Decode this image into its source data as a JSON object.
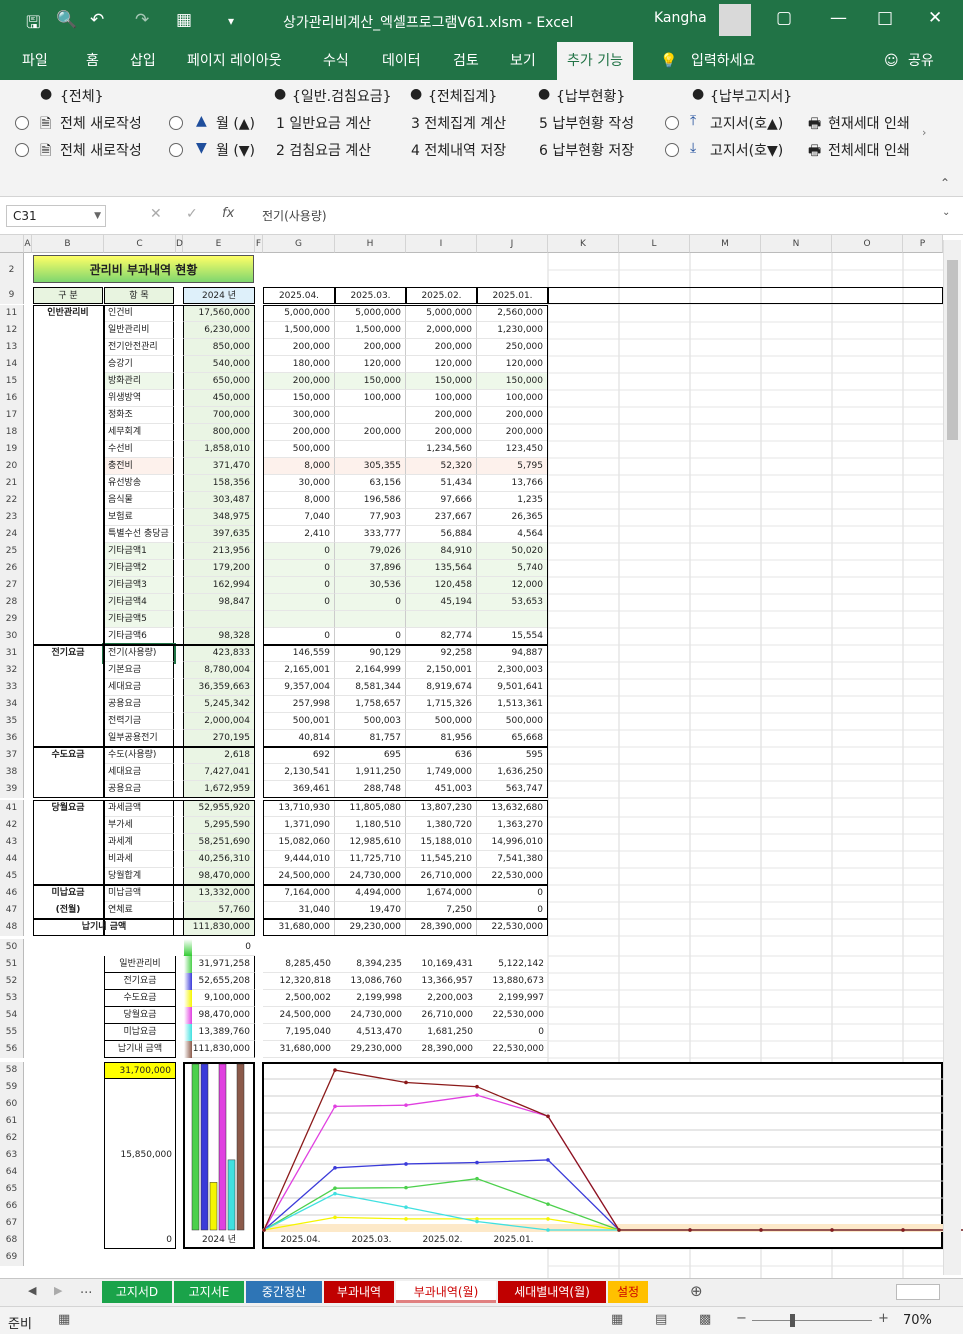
{
  "titlebar": {
    "title": "상가관리비계산_엑셀프로그램V61.xlsm  -  Excel",
    "user": "Kangha"
  },
  "menu": {
    "tabs": [
      "파일",
      "홈",
      "삽입",
      "페이지 레이아웃",
      "수식",
      "데이터",
      "검토",
      "보기",
      "추가 기능"
    ],
    "tellme": "입력하세요",
    "share": "공유"
  },
  "ribbon": {
    "groups": [
      "{전체}",
      "{일반.검침요금}",
      "{전체집계}",
      "{납부현황}",
      "{납부고지서}"
    ],
    "row1": [
      "전체 새로작성",
      "월 (▲)",
      "1  일반요금 계산",
      "3  전체집계 계산",
      "5  납부현황 작성",
      "고지서(호▲)",
      "현재세대 인쇄"
    ],
    "row2": [
      "전체 새로작성",
      "월 (▼)",
      "2  검침요금 계산",
      "4  전체내역 저장",
      "6  납부현황 저장",
      "고지서(호▼)",
      "전체세대 인쇄"
    ]
  },
  "formula": {
    "namebox": "C31",
    "value": "전기(사용량)"
  },
  "columns": [
    "A",
    "B",
    "C",
    "D",
    "E",
    "F",
    "G",
    "H",
    "I",
    "J",
    "K",
    "L",
    "M",
    "N",
    "O",
    "P"
  ],
  "sheet": {
    "title": "관리비 부과내역 현황",
    "header": {
      "gubun": "구  분",
      "hangmok": "항  목",
      "year": "2024 년",
      "months": [
        "2025.04.",
        "2025.03.",
        "2025.02.",
        "2025.01."
      ]
    },
    "sections": [
      {
        "name": "인반관리비",
        "row": 11
      },
      {
        "name": "전기요금",
        "row": 31
      },
      {
        "name": "수도요금",
        "row": 37
      },
      {
        "name": "당월요금",
        "row": 41
      },
      {
        "name": "미납요금",
        "row": 46
      },
      {
        "name": "(전월)",
        "row": 47
      },
      {
        "name": "납기내 금액",
        "row": 48
      }
    ],
    "rows": [
      {
        "r": "11",
        "item": "인건비",
        "year": "17,560,000",
        "m": [
          "5,000,000",
          "5,000,000",
          "5,000,000",
          "2,560,000"
        ]
      },
      {
        "r": "12",
        "item": "일반관리비",
        "year": "6,230,000",
        "m": [
          "1,500,000",
          "1,500,000",
          "2,000,000",
          "1,230,000"
        ]
      },
      {
        "r": "13",
        "item": "전기안전관리",
        "year": "850,000",
        "m": [
          "200,000",
          "200,000",
          "200,000",
          "250,000"
        ]
      },
      {
        "r": "14",
        "item": "승강기",
        "year": "540,000",
        "m": [
          "180,000",
          "120,000",
          "120,000",
          "120,000"
        ]
      },
      {
        "r": "15",
        "item": "방화관리",
        "year": "650,000",
        "m": [
          "200,000",
          "150,000",
          "150,000",
          "150,000"
        ]
      },
      {
        "r": "16",
        "item": "위생방역",
        "year": "450,000",
        "m": [
          "150,000",
          "100,000",
          "100,000",
          "100,000"
        ]
      },
      {
        "r": "17",
        "item": "정화조",
        "year": "700,000",
        "m": [
          "300,000",
          "",
          "200,000",
          "200,000"
        ]
      },
      {
        "r": "18",
        "item": "세무회계",
        "year": "800,000",
        "m": [
          "200,000",
          "200,000",
          "200,000",
          "200,000"
        ]
      },
      {
        "r": "19",
        "item": "수선비",
        "year": "1,858,010",
        "m": [
          "500,000",
          "",
          "1,234,560",
          "123,450"
        ]
      },
      {
        "r": "20",
        "item": "충전비",
        "year": "371,470",
        "m": [
          "8,000",
          "305,355",
          "52,320",
          "5,795"
        ]
      },
      {
        "r": "21",
        "item": "유선방송",
        "year": "158,356",
        "m": [
          "30,000",
          "63,156",
          "51,434",
          "13,766"
        ]
      },
      {
        "r": "22",
        "item": "음식물",
        "year": "303,487",
        "m": [
          "8,000",
          "196,586",
          "97,666",
          "1,235"
        ]
      },
      {
        "r": "23",
        "item": "보험료",
        "year": "348,975",
        "m": [
          "7,040",
          "77,903",
          "237,667",
          "26,365"
        ]
      },
      {
        "r": "24",
        "item": "특별수선 충당금",
        "year": "397,635",
        "m": [
          "2,410",
          "333,777",
          "56,884",
          "4,564"
        ]
      },
      {
        "r": "25",
        "item": "기타금액1",
        "year": "213,956",
        "m": [
          "0",
          "79,026",
          "84,910",
          "50,020"
        ]
      },
      {
        "r": "26",
        "item": "기타금액2",
        "year": "179,200",
        "m": [
          "0",
          "37,896",
          "135,564",
          "5,740"
        ]
      },
      {
        "r": "27",
        "item": "기타금액3",
        "year": "162,994",
        "m": [
          "0",
          "30,536",
          "120,458",
          "12,000"
        ]
      },
      {
        "r": "28",
        "item": "기타금액4",
        "year": "98,847",
        "m": [
          "0",
          "0",
          "45,194",
          "53,653"
        ]
      },
      {
        "r": "29",
        "item": "기타금액5",
        "year": "",
        "m": [
          "",
          "",
          "",
          ""
        ]
      },
      {
        "r": "30",
        "item": "기타금액6",
        "year": "98,328",
        "m": [
          "0",
          "0",
          "82,774",
          "15,554"
        ]
      },
      {
        "r": "31",
        "item": "전기(사용량)",
        "year": "423,833",
        "m": [
          "146,559",
          "90,129",
          "92,258",
          "94,887"
        ]
      },
      {
        "r": "32",
        "item": "기본요금",
        "year": "8,780,004",
        "m": [
          "2,165,001",
          "2,164,999",
          "2,150,001",
          "2,300,003"
        ]
      },
      {
        "r": "33",
        "item": "세대요금",
        "year": "36,359,663",
        "m": [
          "9,357,004",
          "8,581,344",
          "8,919,674",
          "9,501,641"
        ]
      },
      {
        "r": "34",
        "item": "공용요금",
        "year": "5,245,342",
        "m": [
          "257,998",
          "1,758,657",
          "1,715,326",
          "1,513,361"
        ]
      },
      {
        "r": "35",
        "item": "전력기금",
        "year": "2,000,004",
        "m": [
          "500,001",
          "500,003",
          "500,000",
          "500,000"
        ]
      },
      {
        "r": "36",
        "item": "일부공용전기",
        "year": "270,195",
        "m": [
          "40,814",
          "81,757",
          "81,956",
          "65,668"
        ]
      },
      {
        "r": "37",
        "item": "수도(사용량)",
        "year": "2,618",
        "m": [
          "692",
          "695",
          "636",
          "595"
        ]
      },
      {
        "r": "38",
        "item": "세대요금",
        "year": "7,427,041",
        "m": [
          "2,130,541",
          "1,911,250",
          "1,749,000",
          "1,636,250"
        ]
      },
      {
        "r": "39",
        "item": "공용요금",
        "year": "1,672,959",
        "m": [
          "369,461",
          "288,748",
          "451,003",
          "563,747"
        ]
      },
      {
        "r": "41",
        "item": "과세금액",
        "year": "52,955,920",
        "m": [
          "13,710,930",
          "11,805,080",
          "13,807,230",
          "13,632,680"
        ]
      },
      {
        "r": "42",
        "item": "부가세",
        "year": "5,295,590",
        "m": [
          "1,371,090",
          "1,180,510",
          "1,380,720",
          "1,363,270"
        ]
      },
      {
        "r": "43",
        "item": "과세계",
        "year": "58,251,690",
        "m": [
          "15,082,060",
          "12,985,610",
          "15,188,010",
          "14,996,010"
        ]
      },
      {
        "r": "44",
        "item": "비과세",
        "year": "40,256,310",
        "m": [
          "9,444,010",
          "11,725,710",
          "11,545,210",
          "7,541,380"
        ]
      },
      {
        "r": "45",
        "item": "당월합계",
        "year": "98,470,000",
        "m": [
          "24,500,000",
          "24,730,000",
          "26,710,000",
          "22,530,000"
        ]
      },
      {
        "r": "46",
        "item": "미납금액",
        "year": "13,332,000",
        "m": [
          "7,164,000",
          "4,494,000",
          "1,674,000",
          "0"
        ]
      },
      {
        "r": "47",
        "item": "연체료",
        "year": "57,760",
        "m": [
          "31,040",
          "19,470",
          "7,250",
          "0"
        ]
      },
      {
        "r": "48",
        "item": "",
        "year": "111,830,000",
        "m": [
          "31,680,000",
          "29,230,000",
          "28,390,000",
          "22,530,000"
        ]
      }
    ],
    "summary_zero": "0",
    "summary": [
      {
        "r": "51",
        "item": "일반관리비",
        "color": "#4cd04c",
        "year": "31,971,258",
        "m": [
          "8,285,450",
          "8,394,235",
          "10,169,431",
          "5,122,142"
        ]
      },
      {
        "r": "52",
        "item": "전기요금",
        "color": "#3b3bd9",
        "year": "52,655,208",
        "m": [
          "12,320,818",
          "13,086,760",
          "13,366,957",
          "13,880,673"
        ]
      },
      {
        "r": "53",
        "item": "수도요금",
        "color": "#f5f500",
        "year": "9,100,000",
        "m": [
          "2,500,002",
          "2,199,998",
          "2,200,003",
          "2,199,997"
        ]
      },
      {
        "r": "54",
        "item": "당월요금",
        "color": "#e040e0",
        "year": "98,470,000",
        "m": [
          "24,500,000",
          "24,730,000",
          "26,710,000",
          "22,530,000"
        ]
      },
      {
        "r": "55",
        "item": "미납요금",
        "color": "#40e0e0",
        "year": "13,389,760",
        "m": [
          "7,195,040",
          "4,513,470",
          "1,681,250",
          "0"
        ]
      },
      {
        "r": "56",
        "item": "납기내 금액",
        "color": "#8b5a4a",
        "year": "111,830,000",
        "m": [
          "31,680,000",
          "29,230,000",
          "28,390,000",
          "22,530,000"
        ]
      }
    ]
  },
  "chart_data": [
    {
      "type": "bar",
      "categories": [
        "2024 년"
      ],
      "axis_labels": [
        "31,700,000",
        "15,850,000",
        "0"
      ],
      "ylim": [
        0,
        31700000
      ],
      "series": [
        {
          "name": "일반관리비",
          "color": "#4cd04c",
          "values": [
            31971258
          ]
        },
        {
          "name": "전기요금",
          "color": "#3b3bd9",
          "values": [
            52655208
          ]
        },
        {
          "name": "수도요금",
          "color": "#f5f500",
          "values": [
            9100000
          ]
        },
        {
          "name": "당월요금",
          "color": "#e040e0",
          "values": [
            98470000
          ]
        },
        {
          "name": "미납요금",
          "color": "#40e0e0",
          "values": [
            13389760
          ]
        },
        {
          "name": "납기내 금액",
          "color": "#8b5a4a",
          "values": [
            111830000
          ]
        }
      ]
    },
    {
      "type": "line",
      "categories": [
        "2025.04.",
        "2025.03.",
        "2025.02.",
        "2025.01.",
        "",
        "",
        "",
        "",
        "",
        ""
      ],
      "ylim": [
        0,
        31700000
      ],
      "series": [
        {
          "name": "일반관리비",
          "color": "#4cd04c",
          "values": [
            0,
            8285450,
            8394235,
            10169431,
            5122142,
            0,
            0,
            0,
            0,
            0,
            0
          ]
        },
        {
          "name": "전기요금",
          "color": "#3b3bd9",
          "values": [
            0,
            12320818,
            13086760,
            13366957,
            13880673,
            0,
            0,
            0,
            0,
            0,
            0
          ]
        },
        {
          "name": "수도요금",
          "color": "#f5f500",
          "values": [
            0,
            2500002,
            2199998,
            2200003,
            2199997,
            0,
            0,
            0,
            0,
            0,
            0
          ]
        },
        {
          "name": "당월요금",
          "color": "#e040e0",
          "values": [
            0,
            24500000,
            24730000,
            26710000,
            22530000,
            0,
            0,
            0,
            0,
            0,
            0
          ]
        },
        {
          "name": "미납요금",
          "color": "#40e0e0",
          "values": [
            0,
            7195040,
            4513470,
            1681250,
            0,
            0,
            0,
            0,
            0,
            0,
            0
          ]
        },
        {
          "name": "납기내 금액",
          "color": "#8b1a1a",
          "values": [
            0,
            31680000,
            29230000,
            28390000,
            22530000,
            0,
            0,
            0,
            0,
            0,
            0
          ]
        }
      ]
    }
  ],
  "sheet_tabs": [
    {
      "label": "고지서D",
      "color": "#1aa34a"
    },
    {
      "label": "고지서E",
      "color": "#1aa34a"
    },
    {
      "label": "중간정산",
      "color": "#2e75b6"
    },
    {
      "label": "부과내역",
      "color": "#c00000"
    },
    {
      "label": "부과내역(월)",
      "color": "#f3d0d0",
      "active": true
    },
    {
      "label": "세대별내역(월)",
      "color": "#c00000"
    },
    {
      "label": "설정",
      "color": "#ffc000"
    }
  ],
  "status": {
    "ready": "준비",
    "zoom": "70%"
  }
}
